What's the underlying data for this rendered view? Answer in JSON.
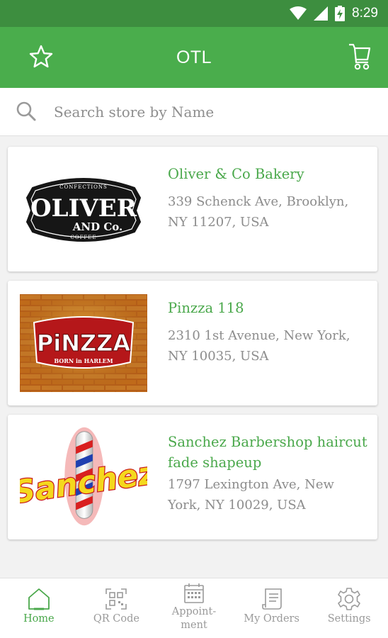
{
  "status_bar": {
    "time": "8:29",
    "icons": [
      "wifi-icon",
      "signal-icon",
      "battery-charging-icon"
    ]
  },
  "app_bar": {
    "title": "OTL",
    "left_icon": "star-icon",
    "right_icon": "cart-icon"
  },
  "search": {
    "placeholder": "Search store by Name",
    "value": ""
  },
  "stores": [
    {
      "name": "Oliver & Co Bakery",
      "address": "339 Schenck Ave, Brooklyn, NY 11207, USA",
      "logo": "oliver-co-logo",
      "logo_text": "OLIVER",
      "logo_sub": "CONFECTIONS",
      "logo_amp": "AND Co.",
      "logo_bottom": "COFFEE"
    },
    {
      "name": "Pinzza 118",
      "address": "2310 1st Avenue, New York, NY 10035, USA",
      "logo": "pinzza-logo",
      "logo_text": "PiNZZA",
      "logo_sub": "BORN in HARLEM"
    },
    {
      "name": "Sanchez Barbershop haircut fade shapeup",
      "address": "1797 Lexington Ave, New York, NY 10029, USA",
      "logo": "sanchez-logo",
      "logo_text": "Sanchez"
    }
  ],
  "bottom_nav": [
    {
      "label": "Home",
      "icon": "home-icon",
      "active": true
    },
    {
      "label": "QR Code",
      "icon": "qr-code-icon",
      "active": false
    },
    {
      "label": "Appoint-\nment",
      "icon": "calendar-icon",
      "active": false
    },
    {
      "label": "My Orders",
      "icon": "orders-icon",
      "active": false
    },
    {
      "label": "Settings",
      "icon": "gear-icon",
      "active": false
    }
  ],
  "colors": {
    "primary": "#4aad4c",
    "primary_dark": "#3d8e3f",
    "accent_text": "#4aa84b",
    "muted_text": "#8c8c8c"
  }
}
